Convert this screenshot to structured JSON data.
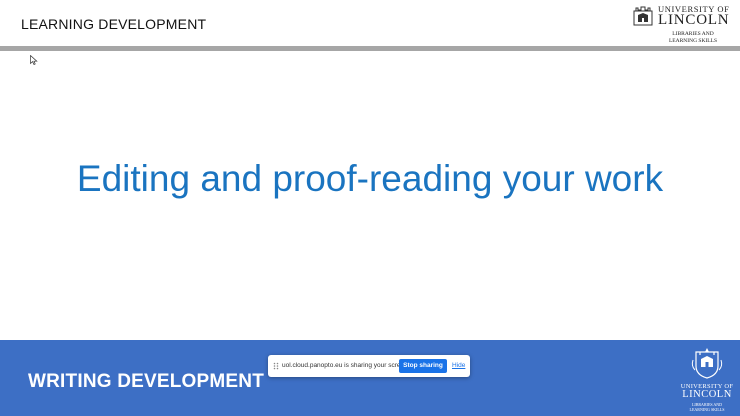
{
  "header": {
    "title": "LEARNING DEVELOPMENT",
    "logo": {
      "university_of": "UNIVERSITY OF",
      "lincoln": "LINCOLN",
      "subtitle_line1": "LIBRARIES AND",
      "subtitle_line2": "LEARNING SKILLS"
    }
  },
  "slide": {
    "title": "Editing and proof-reading your work"
  },
  "footer": {
    "title": "WRITING DEVELOPMENT",
    "logo": {
      "university_of": "UNIVERSITY OF",
      "lincoln": "LINCOLN",
      "subtitle_line1": "LIBRARIES AND",
      "subtitle_line2": "LEARNING SKILLS"
    }
  },
  "share_bar": {
    "message": "uol.cloud.panopto.eu is sharing your screen.",
    "stop_label": "Stop sharing",
    "hide_label": "Hide"
  },
  "colors": {
    "title_blue": "#1a74c0",
    "footer_blue": "#3d6fc5",
    "button_blue": "#1a73e8",
    "rule_gray": "#a6a6a6"
  }
}
